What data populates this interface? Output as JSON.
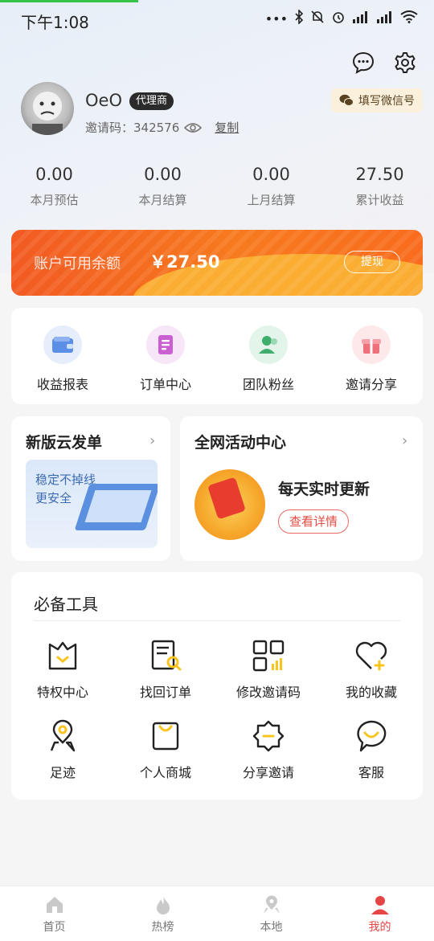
{
  "status_bar": {
    "time": "下午1:08"
  },
  "header": {
    "wechat_button": "填写微信号"
  },
  "profile": {
    "username": "OeO",
    "role_badge": "代理商",
    "invite_label": "邀请码：342576",
    "copy_label": "复制"
  },
  "stats": [
    {
      "value": "0.00",
      "label": "本月预估"
    },
    {
      "value": "0.00",
      "label": "本月结算"
    },
    {
      "value": "0.00",
      "label": "上月结算"
    },
    {
      "value": "27.50",
      "label": "累计收益"
    }
  ],
  "balance": {
    "label": "账户可用余额",
    "amount": "￥27.50",
    "withdraw_label": "提现"
  },
  "quick_actions": [
    {
      "label": "收益报表",
      "icon": "wallet-icon",
      "color": "#e6eefb"
    },
    {
      "label": "订单中心",
      "icon": "order-icon",
      "color": "#f7e6f7"
    },
    {
      "label": "团队粉丝",
      "icon": "team-icon",
      "color": "#e3f5ea"
    },
    {
      "label": "邀请分享",
      "icon": "gift-icon",
      "color": "#fde8ea"
    }
  ],
  "promo": {
    "left_title": "新版云发单",
    "left_subtitle_1": "稳定不掉线",
    "left_subtitle_2": "更安全",
    "right_title": "全网活动中心",
    "right_subtitle": "每天实时更新",
    "right_button": "查看详情"
  },
  "tools": {
    "title": "必备工具",
    "items": [
      {
        "label": "特权中心",
        "icon": "privilege-icon"
      },
      {
        "label": "找回订单",
        "icon": "find-order-icon"
      },
      {
        "label": "修改邀请码",
        "icon": "qrcode-icon"
      },
      {
        "label": "我的收藏",
        "icon": "favorite-icon"
      },
      {
        "label": "足迹",
        "icon": "location-icon"
      },
      {
        "label": "个人商城",
        "icon": "shopping-bag-icon"
      },
      {
        "label": "分享邀请",
        "icon": "share-icon"
      },
      {
        "label": "客服",
        "icon": "service-icon"
      }
    ]
  },
  "bottom_nav": [
    {
      "label": "首页",
      "icon": "home-icon"
    },
    {
      "label": "热榜",
      "icon": "fire-icon"
    },
    {
      "label": "本地",
      "icon": "map-pin-icon"
    },
    {
      "label": "我的",
      "icon": "profile-icon",
      "active": true
    }
  ],
  "colors": {
    "accent": "#f25a22",
    "brand_yellow": "#f7c51e",
    "active_nav": "#e64545"
  }
}
